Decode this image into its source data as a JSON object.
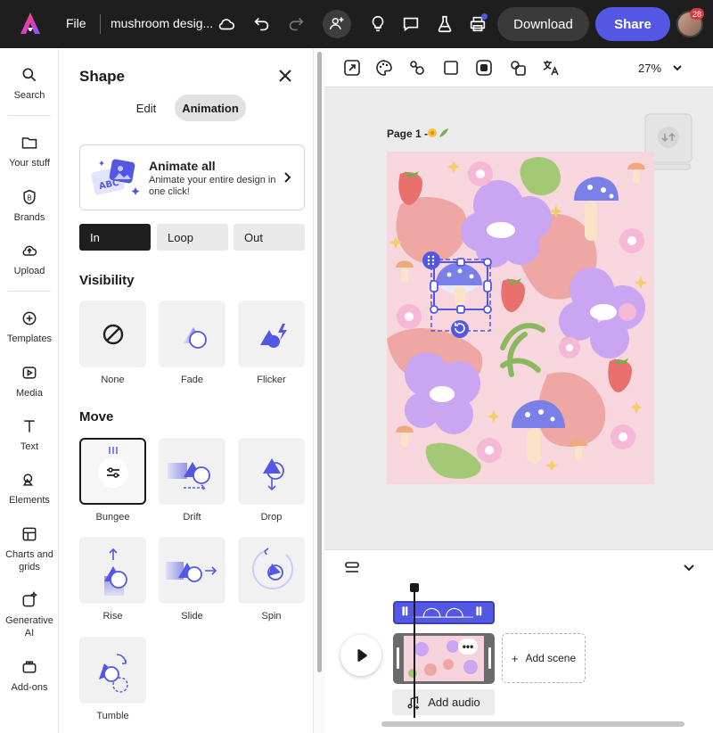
{
  "topbar": {
    "file_label": "File",
    "doc_title": "mushroom desig...",
    "download_label": "Download",
    "share_label": "Share",
    "notification_count": "28",
    "icons": [
      "adobe-express-logo",
      "cloud-icon",
      "undo-icon",
      "redo-icon",
      "invite-icon",
      "lightbulb-icon",
      "comment-icon",
      "flask-icon",
      "print-icon",
      "avatar"
    ]
  },
  "rail": {
    "items": [
      {
        "label": "Search",
        "icon": "search-icon"
      },
      {
        "label": "Your stuff",
        "icon": "folder-icon"
      },
      {
        "label": "Brands",
        "icon": "brand-icon"
      },
      {
        "label": "Upload",
        "icon": "upload-icon"
      },
      {
        "label": "Templates",
        "icon": "templates-icon"
      },
      {
        "label": "Media",
        "icon": "media-icon"
      },
      {
        "label": "Text",
        "icon": "text-icon"
      },
      {
        "label": "Elements",
        "icon": "elements-icon"
      },
      {
        "label": "Charts and grids",
        "icon": "charts-icon"
      },
      {
        "label": "Generative AI",
        "icon": "generative-ai-icon"
      },
      {
        "label": "Add-ons",
        "icon": "addons-icon"
      }
    ]
  },
  "panel": {
    "title": "Shape",
    "tabs": {
      "edit": "Edit",
      "animation": "Animation"
    },
    "animate_all": {
      "title": "Animate all",
      "description": "Animate your entire design in one click!"
    },
    "phases": [
      "In",
      "Loop",
      "Out"
    ],
    "visibility": {
      "heading": "Visibility",
      "options": [
        "None",
        "Fade",
        "Flicker"
      ]
    },
    "move": {
      "heading": "Move",
      "options": [
        "Bungee",
        "Drift",
        "Drop",
        "Rise",
        "Slide",
        "Spin",
        "Tumble"
      ]
    }
  },
  "canvas": {
    "zoom": "27%",
    "page_label": "Page 1 -"
  },
  "timeline": {
    "add_scene": "Add scene",
    "add_audio": "Add audio"
  },
  "colors": {
    "accent": "#5258e4",
    "topbar_bg": "#1e1e1e",
    "artboard_bg": "#f7d7dd"
  }
}
